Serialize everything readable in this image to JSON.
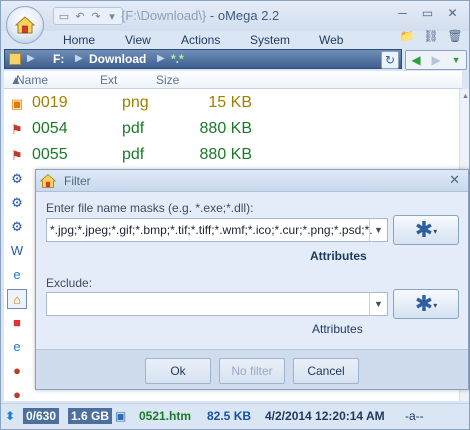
{
  "app": {
    "title_path": "{F:\\Download\\}",
    "title_sep": " - ",
    "title_name": "oMega 2.2"
  },
  "tabs": [
    "Home",
    "View",
    "Actions",
    "System",
    "Web"
  ],
  "pathbar": {
    "drive": "F:",
    "folder": "Download",
    "mask": "*.*"
  },
  "columns": {
    "name": "Name",
    "ext": "Ext",
    "size": "Size"
  },
  "files": [
    {
      "name": "0019",
      "ext": "png",
      "size": "15 KB",
      "color": "#a08000",
      "icon": "image-icon"
    },
    {
      "name": "0054",
      "ext": "pdf",
      "size": "880 KB",
      "color": "#1a7a2a",
      "icon": "pdf-icon"
    },
    {
      "name": "0055",
      "ext": "pdf",
      "size": "880 KB",
      "color": "#1a7a2a",
      "icon": "pdf-icon"
    }
  ],
  "dialog": {
    "title": "Filter",
    "mask_label": "Enter file name masks (e.g. *.exe;*.dll):",
    "mask_value": "*.jpg;*.jpeg;*.gif;*.bmp;*.tif;*.tiff;*.wmf;*.ico;*.cur;*.png;*.psd;*.cdr",
    "attributes_label": "Attributes",
    "exclude_label": "Exclude:",
    "exclude_value": "",
    "exclude_attributes_label": "Attributes",
    "ok": "Ok",
    "no_filter": "No filter",
    "cancel": "Cancel"
  },
  "status": {
    "count": "0/630",
    "size": "1.6 GB",
    "file": "0521.htm",
    "filesize": "82.5 KB",
    "datetime": "4/2/2014 12:20:14 AM",
    "attrs": "-a--"
  }
}
